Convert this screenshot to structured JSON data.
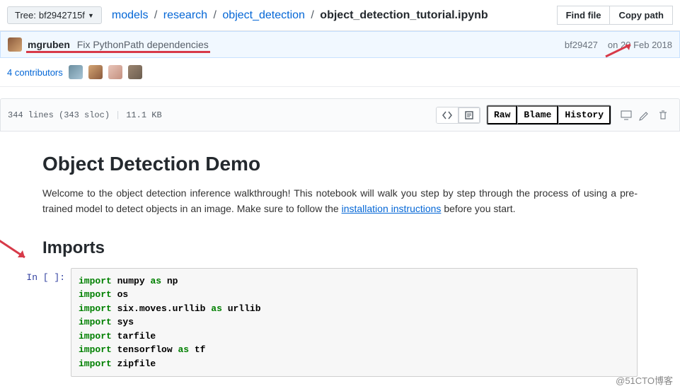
{
  "tree": {
    "label": "Tree:",
    "sha": "bf2942715f"
  },
  "breadcrumb": {
    "p0": "models",
    "p1": "research",
    "p2": "object_detection",
    "final": "object_detection_tutorial.ipynb"
  },
  "top_actions": {
    "find": "Find file",
    "copy": "Copy path"
  },
  "commit": {
    "author": "mgruben",
    "msg": "Fix PythonPath dependencies",
    "sha": "bf29427",
    "date": "on 20 Feb 2018"
  },
  "contrib": {
    "label": "4 contributors"
  },
  "file_meta": {
    "lines": "344 lines (343 sloc)",
    "size": "11.1 KB"
  },
  "file_actions": {
    "raw": "Raw",
    "blame": "Blame",
    "history": "History"
  },
  "notebook": {
    "h1": "Object Detection Demo",
    "p_before": "Welcome to the object detection inference walkthrough! This notebook will walk you step by step through the process of using a pre-trained model to detect objects in an image. Make sure to follow the ",
    "link": "installation instructions",
    "p_after": " before you start.",
    "h2": "Imports",
    "prompt": "In [ ]:"
  },
  "code": {
    "l0k": "import",
    "l0n": "numpy",
    "l0a": "as",
    "l0m": "np",
    "l1k": "import",
    "l1n": "os",
    "l2k": "import",
    "l2n": "six.moves.urllib",
    "l2a": "as",
    "l2m": "urllib",
    "l3k": "import",
    "l3n": "sys",
    "l4k": "import",
    "l4n": "tarfile",
    "l5k": "import",
    "l5n": "tensorflow",
    "l5a": "as",
    "l5m": "tf",
    "l6k": "import",
    "l6n": "zipfile"
  },
  "watermark": "@51CTO博客"
}
